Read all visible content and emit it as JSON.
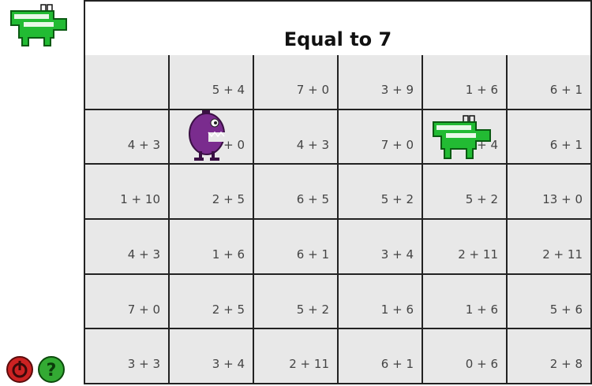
{
  "title": "Equal to 7",
  "grid": [
    [
      "",
      "5 + 4",
      "7 + 0",
      "3 + 9",
      "1 + 6",
      "6 + 1"
    ],
    [
      "4 + 3",
      "7 + 0",
      "4 + 3",
      "7 + 0",
      "6 + 4",
      "6 + 1"
    ],
    [
      "1 + 10",
      "2 + 5",
      "6 + 5",
      "5 + 2",
      "5 + 2",
      "13 + 0"
    ],
    [
      "4 + 3",
      "1 + 6",
      "6 + 1",
      "3 + 4",
      "2 + 11",
      "2 + 11"
    ],
    [
      "7 + 0",
      "2 + 5",
      "5 + 2",
      "1 + 6",
      "1 + 6",
      "5 + 6"
    ],
    [
      "3 + 3",
      "3 + 4",
      "2 + 11",
      "6 + 1",
      "0 + 6",
      "2 + 8"
    ]
  ],
  "icons": {
    "lives": "troggle-life-icon",
    "quit": "quit-power-icon",
    "help": "help-question-icon",
    "player": "muncher-icon",
    "enemy": "troggle-icon"
  },
  "colors": {
    "troggle": "#22bb33",
    "muncher": "#7a2c8e",
    "quit": "#cc2222",
    "help": "#33aa33"
  }
}
